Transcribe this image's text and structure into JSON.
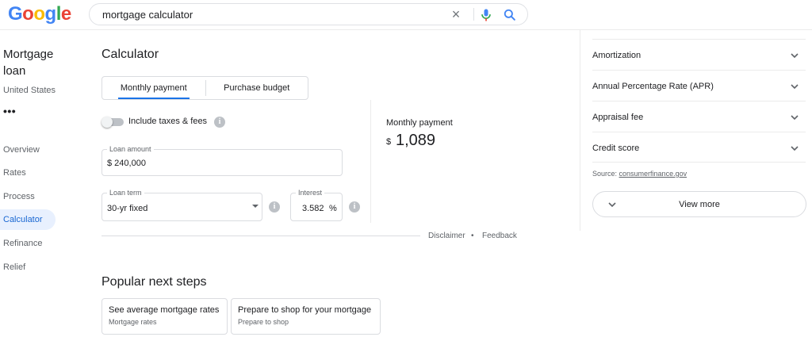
{
  "header": {
    "logo_letters": [
      {
        "char": "G",
        "color": "#4285f4"
      },
      {
        "char": "o",
        "color": "#ea4335"
      },
      {
        "char": "o",
        "color": "#fbbc05"
      },
      {
        "char": "g",
        "color": "#4285f4"
      },
      {
        "char": "l",
        "color": "#34a853"
      },
      {
        "char": "e",
        "color": "#ea4335"
      }
    ],
    "search_query": "mortgage calculator",
    "icons": {
      "clear": "close-icon",
      "voice": "mic-icon",
      "search": "search-icon"
    }
  },
  "sidebar": {
    "title": "Mortgage loan",
    "subtitle": "United States",
    "more": "•••",
    "items": [
      {
        "label": "Overview",
        "active": false
      },
      {
        "label": "Rates",
        "active": false
      },
      {
        "label": "Process",
        "active": false
      },
      {
        "label": "Calculator",
        "active": true
      },
      {
        "label": "Refinance",
        "active": false
      },
      {
        "label": "Relief",
        "active": false
      }
    ]
  },
  "calculator": {
    "title": "Calculator",
    "tabs": [
      {
        "label": "Monthly payment",
        "selected": true
      },
      {
        "label": "Purchase budget",
        "selected": false
      }
    ],
    "toggle_label": "Include taxes & fees",
    "toggle_on": false,
    "loan_amount": {
      "label": "Loan amount",
      "value": "$ 240,000"
    },
    "loan_term": {
      "label": "Loan term",
      "value": "30-yr fixed"
    },
    "interest": {
      "label": "Interest",
      "value": "3.582",
      "unit": "%"
    },
    "monthly_payment": {
      "label": "Monthly payment",
      "currency": "$",
      "amount": "1,089"
    },
    "footer": {
      "disclaimer": "Disclaimer",
      "separator": "•",
      "feedback": "Feedback"
    }
  },
  "next_steps": {
    "title": "Popular next steps",
    "cards": [
      {
        "title": "See average mortgage rates",
        "subtitle": "Mortgage rates"
      },
      {
        "title": "Prepare to shop for your mortgage",
        "subtitle": "Prepare to shop"
      }
    ]
  },
  "faq": {
    "items": [
      {
        "label": "Amortization"
      },
      {
        "label": "Annual Percentage Rate (APR)"
      },
      {
        "label": "Appraisal fee"
      },
      {
        "label": "Credit score"
      }
    ],
    "source_prefix": "Source: ",
    "source_link": "consumerfinance.gov",
    "view_more": "View more"
  },
  "colors": {
    "accent": "#1a73e8",
    "active_nav_bg": "#e8f0fe",
    "active_nav_text": "#1967d2"
  }
}
